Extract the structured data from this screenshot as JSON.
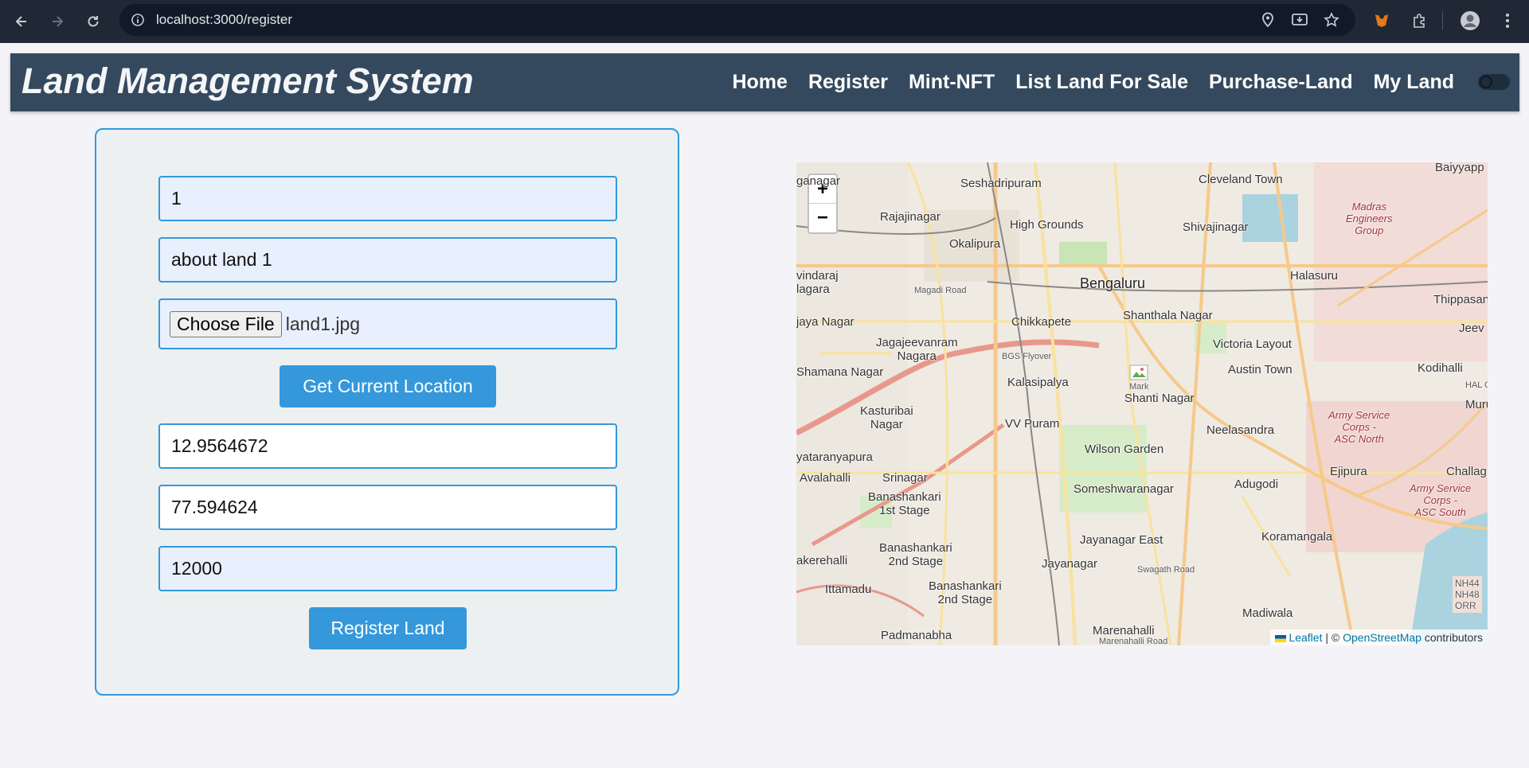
{
  "browser": {
    "url": "localhost:3000/register"
  },
  "header": {
    "title": "Land Management System",
    "nav": [
      "Home",
      "Register",
      "Mint-NFT",
      "List Land For Sale",
      "Purchase-Land",
      "My Land"
    ]
  },
  "form": {
    "land_id_value": "1",
    "description_value": "about land 1",
    "file_button_label": "Choose File",
    "file_name": "land1.jpg",
    "location_button_label": "Get Current Location",
    "latitude_value": "12.9564672",
    "longitude_value": "77.594624",
    "price_value": "12000",
    "submit_button_label": "Register Land"
  },
  "map": {
    "zoom_in": "+",
    "zoom_out": "−",
    "attribution": {
      "leaflet": "Leaflet",
      "separator": " | © ",
      "osm": "OpenStreetMap",
      "suffix": " contributors"
    },
    "marker_label": "Mark",
    "labels": {
      "city": "Bengaluru",
      "seshadripuram": "Seshadripuram",
      "cleveland": "Cleveland Town",
      "baiyyappa": "Baiyyapp",
      "rajajinagar": "Rajajinagar",
      "madras": "Madras\nEngineers\nGroup",
      "okalipura": "Okalipura",
      "high_grounds": "High Grounds",
      "shivajinagar": "Shivajinagar",
      "vindaraj": "vindaraj\nlagara",
      "magadi": "Magadi Road",
      "halasuru": "Halasuru",
      "chikkapete": "Chikkapete",
      "shanthala": "Shanthala Nagar",
      "thippasan": "Thippasan",
      "jaya_nagar": "jaya Nagar",
      "jagajeevanram": "Jagajeevanram\nNagara",
      "victoria": "Victoria Layout",
      "jeev": "Jeev",
      "shamana": "Shamana Nagar",
      "kalasipalya": "Kalasipalya",
      "shanti": "Shanti Nagar",
      "austin": "Austin Town",
      "kodihalli": "Kodihalli",
      "kasturibai": "Kasturibai\nNagar",
      "vv_puram": "VV Puram",
      "neelasandra": "Neelasandra",
      "army_north": "Army Service\nCorps -\nASC North",
      "muru": "Muru",
      "yataranyapura": "yataranyapura",
      "wilson": "Wilson Garden",
      "avalahalli": "Avalahalli",
      "srinagar": "Srinagar",
      "someshwaranagar": "Someshwaranagar",
      "adugodi": "Adugodi",
      "ejipura": "Ejipura",
      "challagh": "Challagh",
      "banashankari1": "Banashankari\n1st Stage",
      "army_south": "Army Service\nCorps -\nASC South",
      "jayanagar_east": "Jayanagar East",
      "koramangala": "Koramangala",
      "banashankari2": "Banashankari\n2nd Stage",
      "akerehalli": "akerehalli",
      "jayanagar": "Jayanagar",
      "swagath": "Swagath Road",
      "ittamadu": "Ittamadu",
      "banashankari2b": "Banashankari\n2nd Stage",
      "nh": "NH44\nNH48\nORR",
      "madiwala": "Madiwala",
      "padmanabha": "Padmanabha",
      "marenahalli": "Marenahalli",
      "marenahalli_road": "Marenahalli Road",
      "ganagar": "ganagar",
      "hal": "HAL O",
      "bgs": "BGS Flyover"
    }
  }
}
